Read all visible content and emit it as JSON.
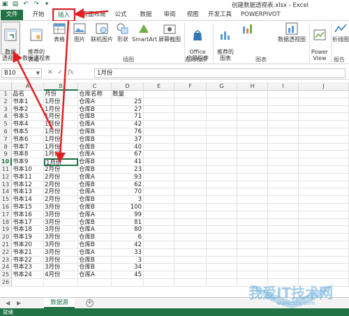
{
  "window": {
    "title": "创建数据透视表.xlsx - Excel"
  },
  "tabs": [
    "文件",
    "开始",
    "插入",
    "页面布局",
    "公式",
    "数据",
    "审阅",
    "视图",
    "开发工具",
    "POWERPIVOT"
  ],
  "ribbon": {
    "pivot_table": "数据\n透视表",
    "recommended_pivot": "推荐的\n数据透视表",
    "table": "表格",
    "picture": "图片",
    "online_picture": "联机图片",
    "shapes": "形状",
    "smartart": "SmartArt",
    "screenshot": "屏幕截图",
    "office_apps": "Office\n应用程序",
    "recommended_charts": "推荐的\n图表",
    "pivot_chart": "数据透视图",
    "power_view": "Power\nView",
    "sparkline": "折线图",
    "groups": {
      "tables": "表格",
      "illustrations": "插图",
      "apps": "应用程序",
      "charts": "图表",
      "reports": "报告"
    }
  },
  "formula_bar": {
    "name_box": "B10",
    "value": "1月份"
  },
  "columns": [
    "A",
    "B",
    "C",
    "D",
    "E",
    "F",
    "G",
    "H",
    "I",
    "J"
  ],
  "headers": {
    "name": "品名",
    "month": "月份",
    "warehouse": "仓库名称",
    "qty": "数量"
  },
  "rows": [
    {
      "name": "书本1",
      "month": "1月份",
      "wh": "仓库A",
      "qty": "25"
    },
    {
      "name": "书本2",
      "month": "1月份",
      "wh": "仓库B",
      "qty": "27"
    },
    {
      "name": "书本3",
      "month": "1月份",
      "wh": "仓库B",
      "qty": "71"
    },
    {
      "name": "书本4",
      "month": "1月份",
      "wh": "仓库A",
      "qty": "42"
    },
    {
      "name": "书本5",
      "month": "1月份",
      "wh": "仓库B",
      "qty": "76"
    },
    {
      "name": "书本6",
      "month": "1月份",
      "wh": "仓库B",
      "qty": "37"
    },
    {
      "name": "书本7",
      "month": "1月份",
      "wh": "仓库B",
      "qty": "40"
    },
    {
      "name": "书本8",
      "month": "1月份",
      "wh": "仓库A",
      "qty": "67"
    },
    {
      "name": "书本9",
      "month": "1月份",
      "wh": "仓库B",
      "qty": "41"
    },
    {
      "name": "书本10",
      "month": "2月份",
      "wh": "仓库B",
      "qty": "23"
    },
    {
      "name": "书本11",
      "month": "2月份",
      "wh": "仓库A",
      "qty": "93"
    },
    {
      "name": "书本12",
      "month": "2月份",
      "wh": "仓库B",
      "qty": "62"
    },
    {
      "name": "书本13",
      "month": "2月份",
      "wh": "仓库A",
      "qty": "70"
    },
    {
      "name": "书本14",
      "month": "2月份",
      "wh": "仓库B",
      "qty": "3"
    },
    {
      "name": "书本15",
      "month": "3月份",
      "wh": "仓库B",
      "qty": "100"
    },
    {
      "name": "书本16",
      "month": "3月份",
      "wh": "仓库A",
      "qty": "99"
    },
    {
      "name": "书本17",
      "month": "3月份",
      "wh": "仓库B",
      "qty": "81"
    },
    {
      "name": "书本18",
      "month": "3月份",
      "wh": "仓库A",
      "qty": "80"
    },
    {
      "name": "书本19",
      "month": "3月份",
      "wh": "仓库B",
      "qty": "6"
    },
    {
      "name": "书本20",
      "month": "3月份",
      "wh": "仓库B",
      "qty": "42"
    },
    {
      "name": "书本21",
      "month": "3月份",
      "wh": "仓库A",
      "qty": "33"
    },
    {
      "name": "书本22",
      "month": "3月份",
      "wh": "仓库B",
      "qty": "3"
    },
    {
      "name": "书本23",
      "month": "3月份",
      "wh": "仓库B",
      "qty": "34"
    },
    {
      "name": "书本24",
      "month": "4月份",
      "wh": "仓库A",
      "qty": "45"
    }
  ],
  "extra_row_numbers": [
    "26"
  ],
  "sheet_tab": "数据源",
  "status": "就绪",
  "watermark": {
    "text": "我爱IT技术网",
    "url": "www.52ij.com"
  },
  "colors": {
    "excel_green": "#217346",
    "annotation_red": "#e02020"
  }
}
